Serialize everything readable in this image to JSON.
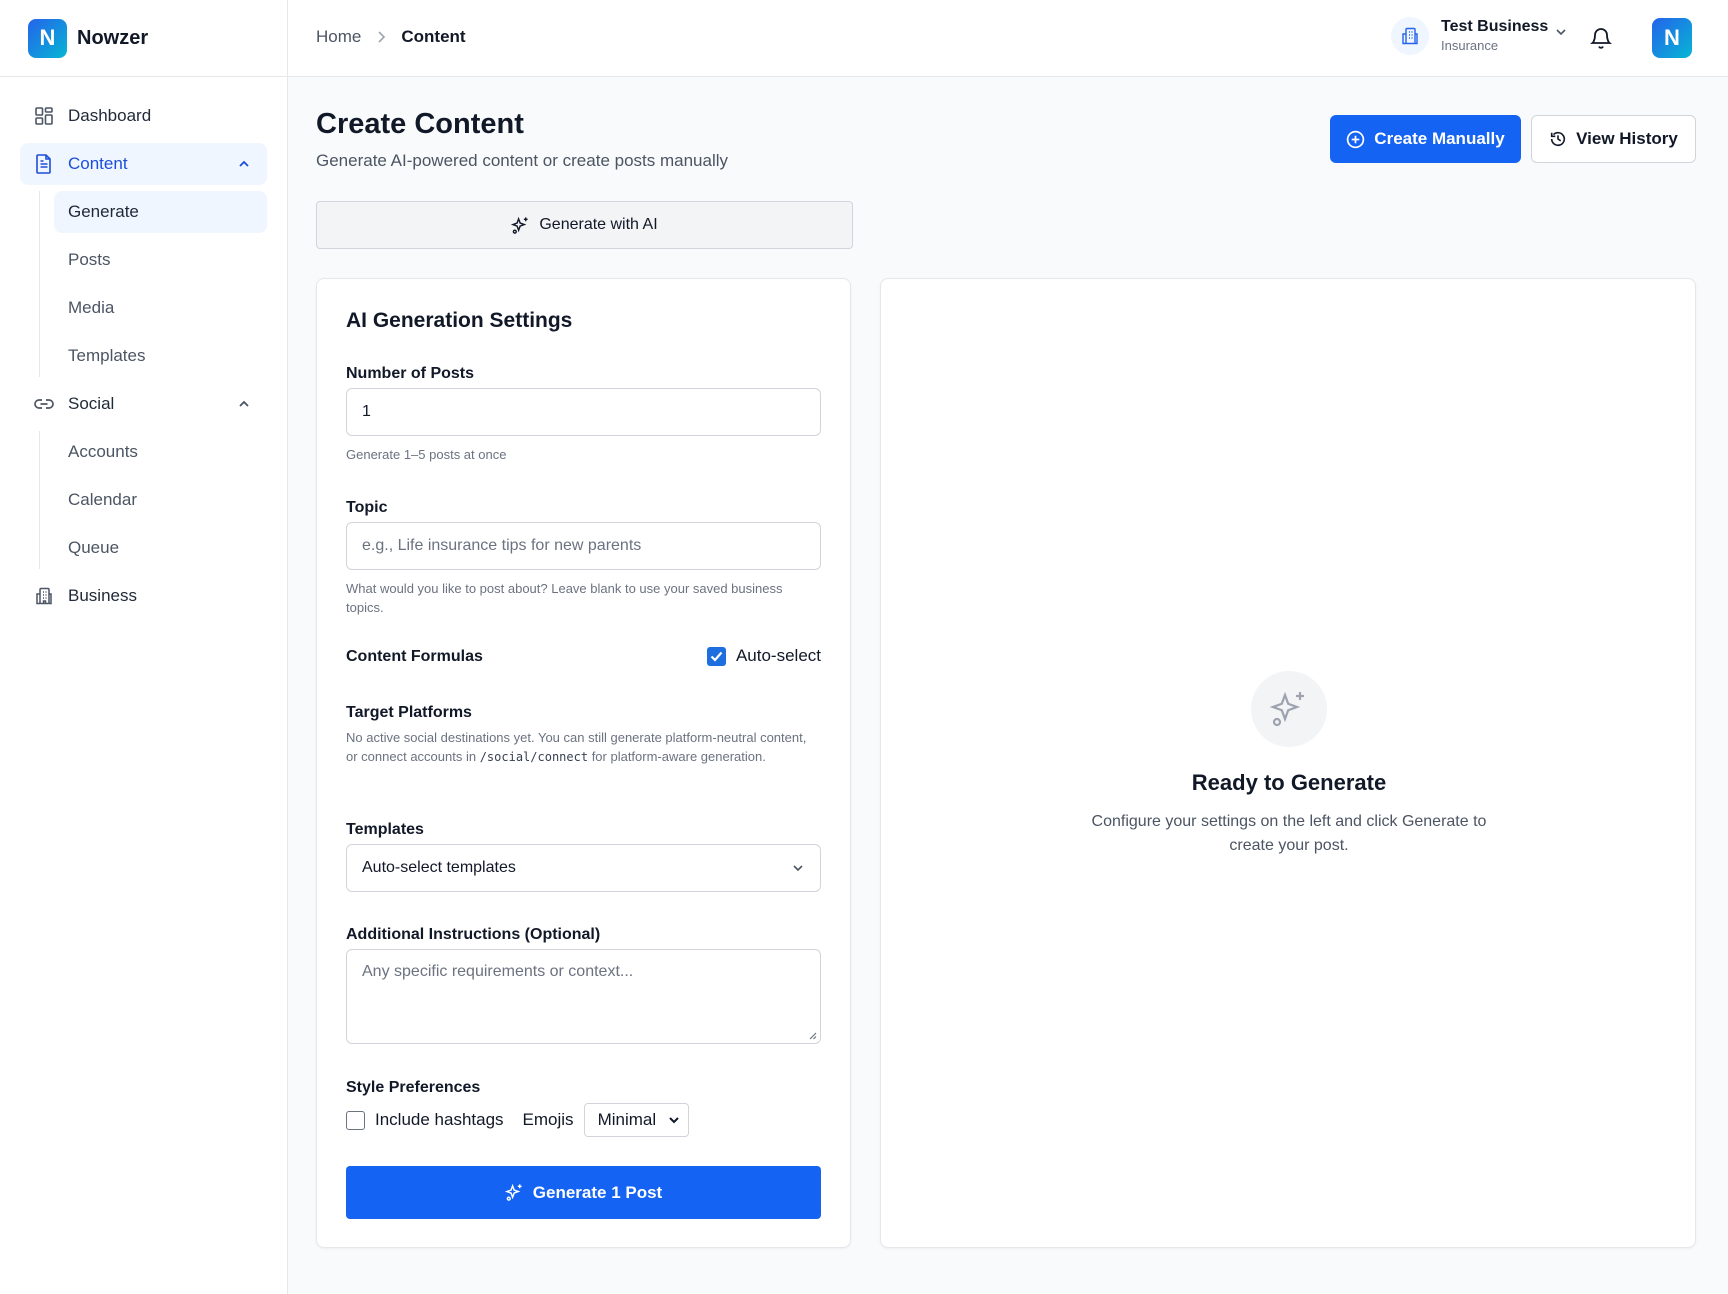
{
  "app": {
    "logo_letter": "N",
    "name": "Nowzer"
  },
  "sidebar": {
    "dashboard": "Dashboard",
    "content": {
      "label": "Content",
      "children": [
        "Generate",
        "Posts",
        "Media",
        "Templates"
      ]
    },
    "social": {
      "label": "Social",
      "children": [
        "Accounts",
        "Calendar",
        "Queue"
      ]
    },
    "business": "Business"
  },
  "topbar": {
    "breadcrumb": {
      "home": "Home",
      "current": "Content"
    },
    "business_name": "Test Business",
    "business_type": "Insurance",
    "avatar_letter": "N"
  },
  "header": {
    "title": "Create Content",
    "subtitle": "Generate AI-powered content or create posts manually",
    "create_manually": "Create Manually",
    "view_history": "View History"
  },
  "tab": {
    "label": "Generate with AI"
  },
  "settings": {
    "title": "AI Generation Settings",
    "num_posts": {
      "label": "Number of Posts",
      "value": "1",
      "hint": "Generate 1–5 posts at once"
    },
    "topic": {
      "label": "Topic",
      "placeholder": "e.g., Life insurance tips for new parents",
      "hint": "What would you like to post about? Leave blank to use your saved business topics."
    },
    "formulas": {
      "label": "Content Formulas",
      "auto_select_label": "Auto-select",
      "auto_select_checked": true
    },
    "platforms": {
      "label": "Target Platforms",
      "hint_before": "No active social destinations yet. You can still generate platform-neutral content, or connect accounts in ",
      "hint_code": "/social/connect",
      "hint_after": " for platform-aware generation."
    },
    "templates": {
      "label": "Templates",
      "value": "Auto-select templates"
    },
    "instructions": {
      "label": "Additional Instructions (Optional)",
      "placeholder": "Any specific requirements or context..."
    },
    "style": {
      "label": "Style Preferences",
      "hashtags_label": "Include hashtags",
      "hashtags_checked": false,
      "emojis_label": "Emojis",
      "emojis_value": "Minimal"
    },
    "generate_button": "Generate 1 Post"
  },
  "preview": {
    "title": "Ready to Generate",
    "text": "Configure your settings on the left and click Generate to create your post."
  },
  "colors": {
    "primary": "#1463f3",
    "active_bg": "#eff6ff",
    "active_text": "#1d4ed8"
  }
}
